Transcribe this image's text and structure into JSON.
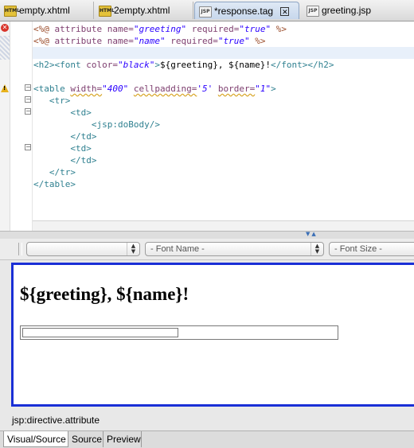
{
  "tabs": [
    {
      "label": "empty.xhtml",
      "icon": "html-file-icon"
    },
    {
      "label": "2empty.xhtml",
      "icon": "html-file-icon"
    },
    {
      "label": "*response.tag",
      "icon": "jsp-file-icon",
      "active": true
    },
    {
      "label": "greeting.jsp",
      "icon": "jsp-file-icon"
    }
  ],
  "editor": {
    "lines": [
      {
        "parts": [
          [
            "dir",
            "<%@ "
          ],
          [
            "attr",
            "attribute "
          ],
          [
            "attr",
            "name="
          ],
          [
            "val",
            "\"greeting\""
          ],
          [
            "attr",
            " required="
          ],
          [
            "val",
            "\"true\""
          ],
          [
            "dir",
            " %>"
          ]
        ]
      },
      {
        "parts": [
          [
            "dir",
            "<%@ "
          ],
          [
            "attr",
            "attribute "
          ],
          [
            "attr",
            "name="
          ],
          [
            "val",
            "\"name\""
          ],
          [
            "attr",
            " required="
          ],
          [
            "val",
            "\"true\""
          ],
          [
            "dir",
            " %>"
          ]
        ]
      },
      {
        "parts": []
      },
      {
        "parts": [
          [
            "tag",
            "<h2><font "
          ],
          [
            "attr",
            "color="
          ],
          [
            "val",
            "\"black\""
          ],
          [
            "tag",
            ">"
          ],
          [
            "txt",
            "${greeting}, ${name}!"
          ],
          [
            "tag",
            "</font></h2>"
          ]
        ]
      },
      {
        "parts": []
      },
      {
        "parts": [
          [
            "tag",
            "<table "
          ],
          [
            "attrsq",
            "width="
          ],
          [
            "val",
            "\"400\""
          ],
          [
            "attr",
            " "
          ],
          [
            "attrsq",
            "cellpadding="
          ],
          [
            "val",
            "'5'"
          ],
          [
            "attr",
            " "
          ],
          [
            "attrsq",
            "border="
          ],
          [
            "val",
            "\"1\""
          ],
          [
            "tag",
            ">"
          ]
        ]
      },
      {
        "parts": [
          [
            "tag",
            "   <tr>"
          ]
        ]
      },
      {
        "parts": [
          [
            "tag",
            "       <td>"
          ]
        ]
      },
      {
        "parts": [
          [
            "tag",
            "           <jsp:doBody/>"
          ]
        ]
      },
      {
        "parts": [
          [
            "tag",
            "       </td>"
          ]
        ]
      },
      {
        "parts": [
          [
            "tag",
            "       <td>"
          ]
        ]
      },
      {
        "parts": [
          [
            "tag",
            "       </td>"
          ]
        ]
      },
      {
        "parts": [
          [
            "tag",
            "   </tr>"
          ]
        ]
      },
      {
        "parts": [
          [
            "tag",
            "</table>"
          ]
        ]
      }
    ]
  },
  "toolbar": {
    "style_value": "",
    "font_name": "- Font Name -",
    "font_size": "- Font Size -"
  },
  "visual": {
    "heading": "${greeting}, ${name}!"
  },
  "status": {
    "text": "jsp:directive.attribute"
  },
  "bottom_tabs": [
    "Visual/Source",
    "Source",
    "Preview"
  ],
  "colors": {
    "selection_border": "#1a2fd6",
    "error": "#d8342a",
    "warning": "#e8b21d"
  }
}
